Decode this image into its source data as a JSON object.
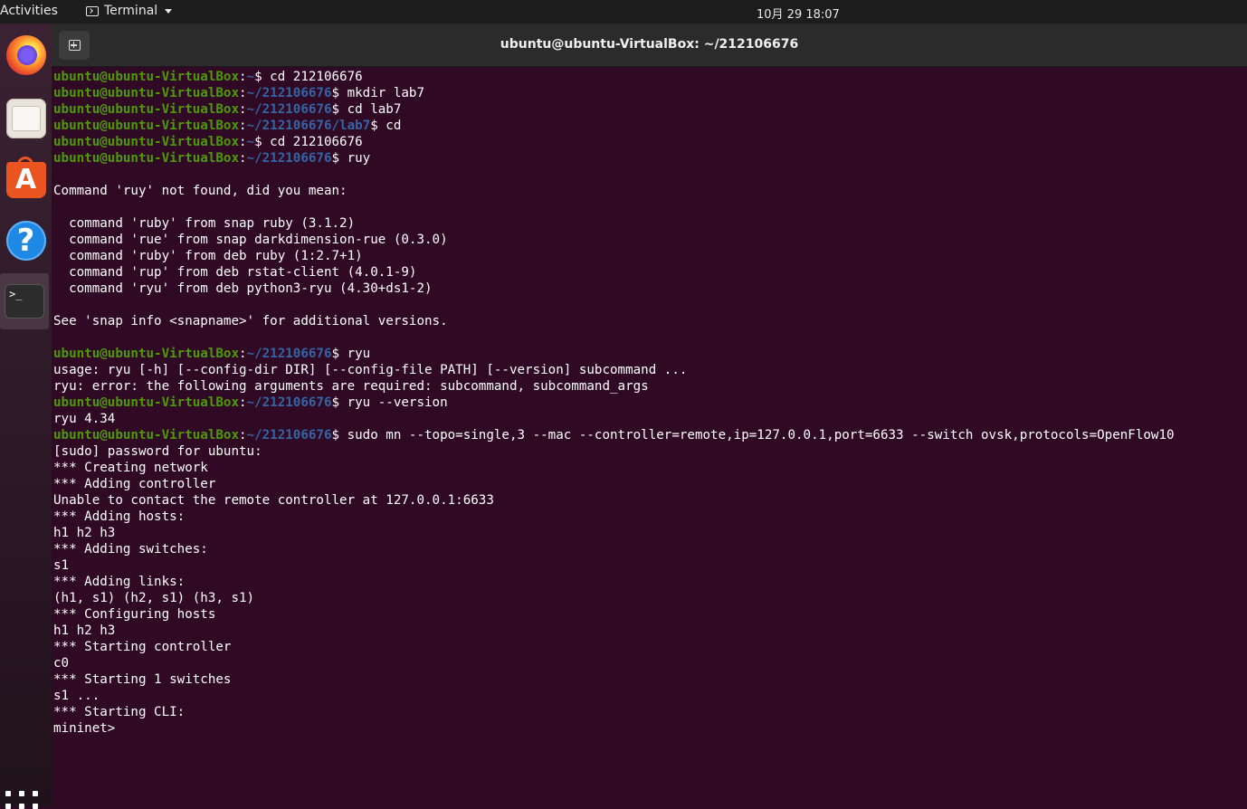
{
  "topbar": {
    "activities": "Activities",
    "app_menu": "Terminal",
    "clock": "10月 29  18:07"
  },
  "dock": {
    "items": [
      "firefox-icon",
      "files-icon",
      "software-store-icon",
      "help-icon",
      "terminal-icon"
    ],
    "terminal_glyph": ">_",
    "store_glyph": "A",
    "help_glyph": "?"
  },
  "window": {
    "title": "ubuntu@ubuntu-VirtualBox: ~/212106676"
  },
  "colors": {
    "terminal_bg": "#300a24",
    "prompt_user": "#4e9a06",
    "prompt_path": "#3465a4",
    "text": "#ffffff"
  },
  "terminal": {
    "lines": [
      {
        "user": "ubuntu@ubuntu-VirtualBox",
        "path": "~",
        "cmd": "$ cd 212106676"
      },
      {
        "user": "ubuntu@ubuntu-VirtualBox",
        "path": "~/212106676",
        "cmd": "$ mkdir lab7"
      },
      {
        "user": "ubuntu@ubuntu-VirtualBox",
        "path": "~/212106676",
        "cmd": "$ cd lab7"
      },
      {
        "user": "ubuntu@ubuntu-VirtualBox",
        "path": "~/212106676/lab7",
        "cmd": "$ cd"
      },
      {
        "user": "ubuntu@ubuntu-VirtualBox",
        "path": "~",
        "cmd": "$ cd 212106676"
      },
      {
        "user": "ubuntu@ubuntu-VirtualBox",
        "path": "~/212106676",
        "cmd": "$ ruy"
      },
      {
        "text": ""
      },
      {
        "text": "Command 'ruy' not found, did you mean:"
      },
      {
        "text": ""
      },
      {
        "text": "  command 'ruby' from snap ruby (3.1.2)"
      },
      {
        "text": "  command 'rue' from snap darkdimension-rue (0.3.0)"
      },
      {
        "text": "  command 'ruby' from deb ruby (1:2.7+1)"
      },
      {
        "text": "  command 'rup' from deb rstat-client (4.0.1-9)"
      },
      {
        "text": "  command 'ryu' from deb python3-ryu (4.30+ds1-2)"
      },
      {
        "text": ""
      },
      {
        "text": "See 'snap info <snapname>' for additional versions."
      },
      {
        "text": ""
      },
      {
        "user": "ubuntu@ubuntu-VirtualBox",
        "path": "~/212106676",
        "cmd": "$ ryu"
      },
      {
        "text": "usage: ryu [-h] [--config-dir DIR] [--config-file PATH] [--version] subcommand ..."
      },
      {
        "text": "ryu: error: the following arguments are required: subcommand, subcommand_args"
      },
      {
        "user": "ubuntu@ubuntu-VirtualBox",
        "path": "~/212106676",
        "cmd": "$ ryu --version"
      },
      {
        "text": "ryu 4.34"
      },
      {
        "user": "ubuntu@ubuntu-VirtualBox",
        "path": "~/212106676",
        "cmd": "$ sudo mn --topo=single,3 --mac --controller=remote,ip=127.0.0.1,port=6633 --switch ovsk,protocols=OpenFlow10"
      },
      {
        "text": "[sudo] password for ubuntu:"
      },
      {
        "text": "*** Creating network"
      },
      {
        "text": "*** Adding controller"
      },
      {
        "text": "Unable to contact the remote controller at 127.0.0.1:6633"
      },
      {
        "text": "*** Adding hosts:"
      },
      {
        "text": "h1 h2 h3"
      },
      {
        "text": "*** Adding switches:"
      },
      {
        "text": "s1"
      },
      {
        "text": "*** Adding links:"
      },
      {
        "text": "(h1, s1) (h2, s1) (h3, s1)"
      },
      {
        "text": "*** Configuring hosts"
      },
      {
        "text": "h1 h2 h3"
      },
      {
        "text": "*** Starting controller"
      },
      {
        "text": "c0"
      },
      {
        "text": "*** Starting 1 switches"
      },
      {
        "text": "s1 ..."
      },
      {
        "text": "*** Starting CLI:"
      },
      {
        "text": "mininet>"
      }
    ]
  }
}
